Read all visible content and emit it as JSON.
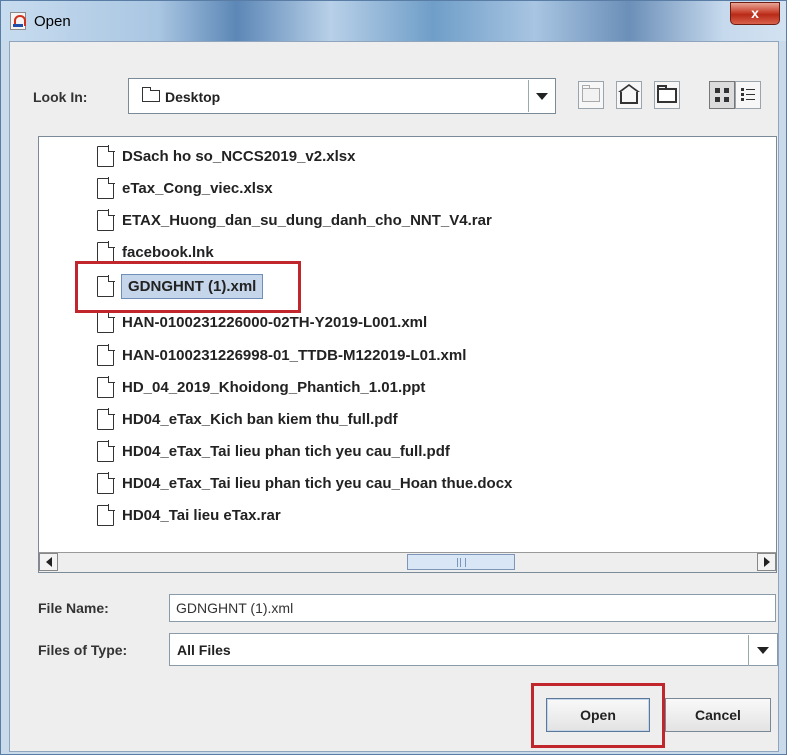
{
  "window": {
    "title": "Open",
    "close_glyph": "x"
  },
  "lookin": {
    "label": "Look In:",
    "value": "Desktop"
  },
  "toolbar": {
    "icons": [
      "up-folder-icon",
      "home-icon",
      "new-folder-icon",
      "list-view-icon",
      "details-view-icon"
    ]
  },
  "files": [
    "DSach ho so_NCCS2019_v2.xlsx",
    "eTax_Cong_viec.xlsx",
    "ETAX_Huong_dan_su_dung_danh_cho_NNT_V4.rar",
    "facebook.lnk",
    "GDNGHNT (1).xml",
    "HAN-0100231226000-02TH-Y2019-L001.xml",
    "HAN-0100231226998-01_TTDB-M122019-L01.xml",
    "HD_04_2019_Khoidong_Phantich_1.01.ppt",
    "HD04_eTax_Kich ban kiem thu_full.pdf",
    "HD04_eTax_Tai lieu phan tich yeu cau_full.pdf",
    "HD04_eTax_Tai lieu phan tich yeu cau_Hoan thue.docx",
    "HD04_Tai lieu eTax.rar"
  ],
  "selected_index": 4,
  "filename": {
    "label": "File Name:",
    "value": "GDNGHNT (1).xml"
  },
  "filetype": {
    "label": "Files of Type:",
    "value": "All Files"
  },
  "buttons": {
    "open": "Open",
    "cancel": "Cancel"
  },
  "colors": {
    "highlight": "#c0262c",
    "selection": "#c6d6ea"
  }
}
